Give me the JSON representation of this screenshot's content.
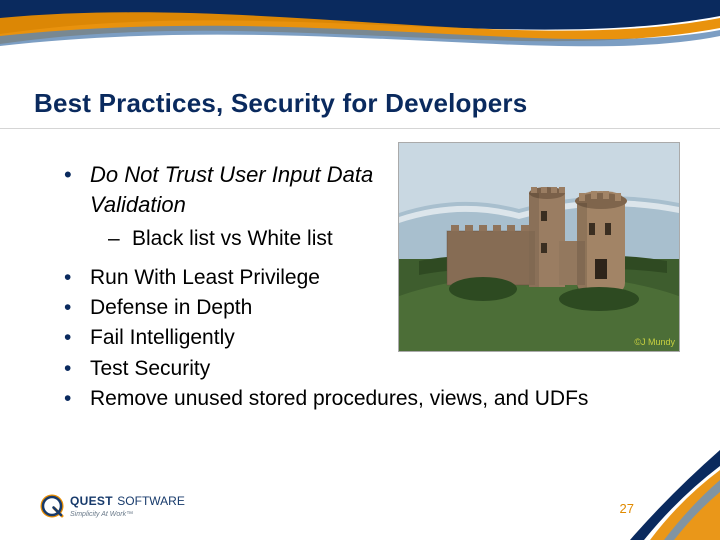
{
  "title": "Best Practices, Security for Developers",
  "bullets": {
    "main": {
      "text": "Do Not Trust User Input Data Validation",
      "sub": "Black list vs White list"
    },
    "items": [
      "Run With Least Privilege",
      "Defense in Depth",
      "Fail Intelligently",
      "Test Security",
      "Remove unused stored procedures, views, and UDFs"
    ]
  },
  "image": {
    "caption": "©J Mundy"
  },
  "logo": {
    "line1a": "QUEST",
    "line1b": "SOFTWARE",
    "tagline": "Simplicity At Work™"
  },
  "page_number": "27"
}
